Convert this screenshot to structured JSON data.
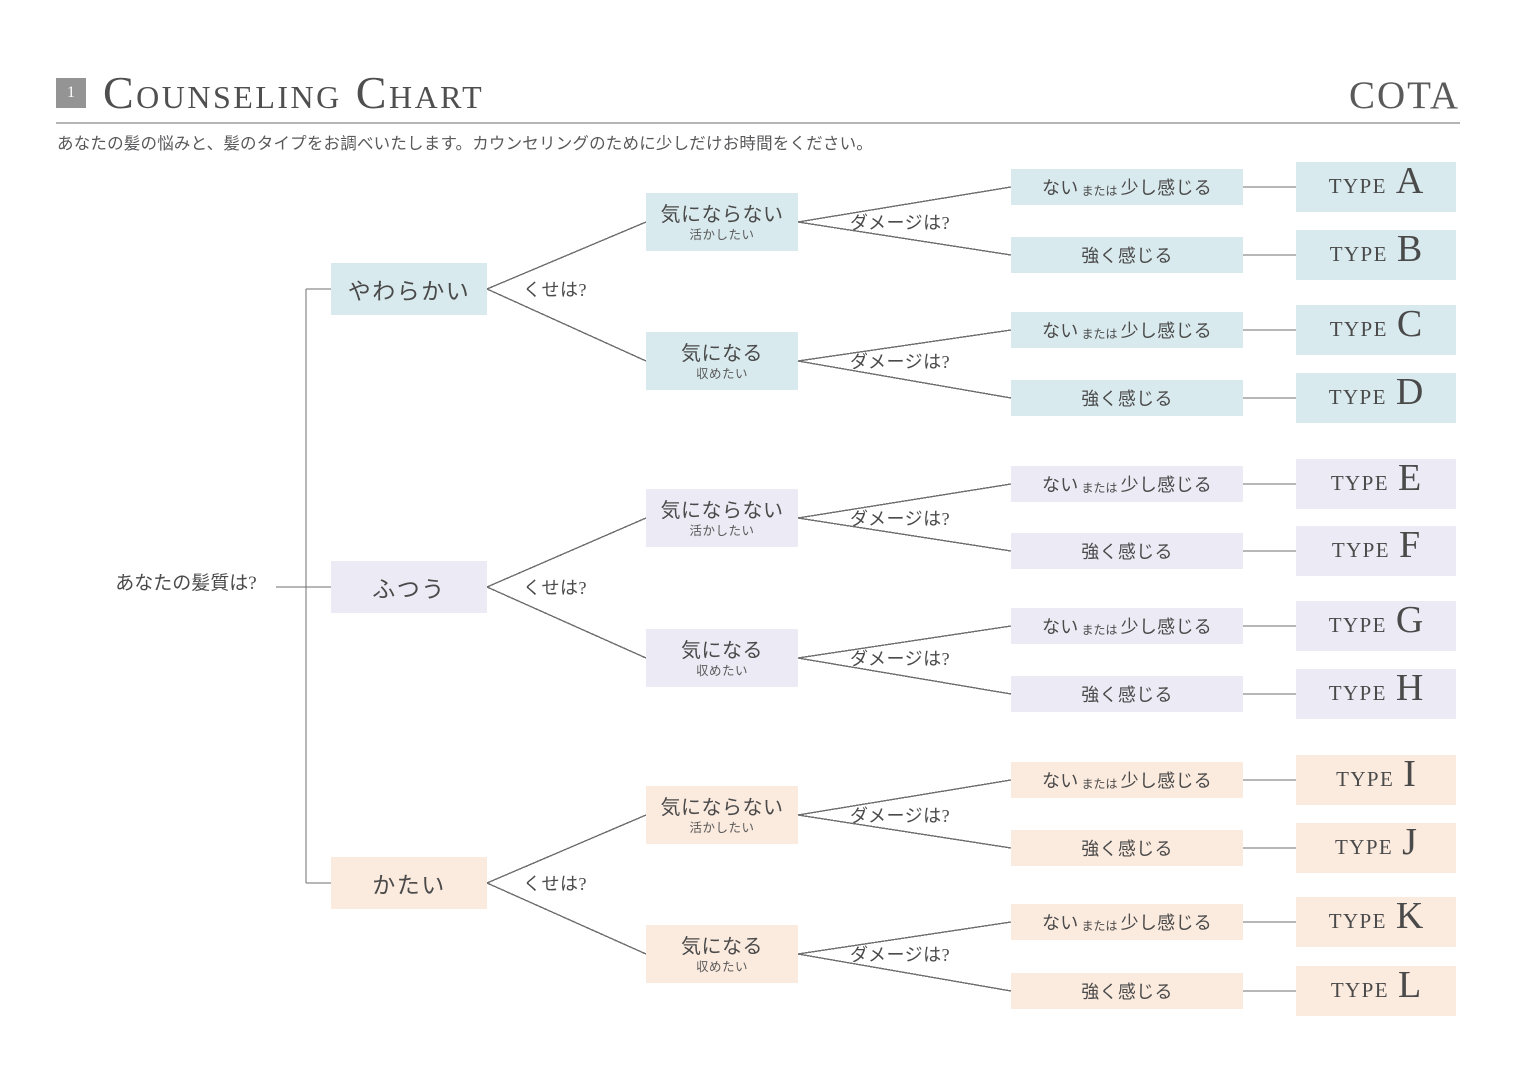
{
  "header": {
    "badge_number": "1",
    "title": "Counseling Chart",
    "brand": "COTA",
    "subtitle": "あなたの髪の悩みと、髪のタイプをお調べいたします。カウンセリングのために少しだけお時間をください。"
  },
  "colors": {
    "blue": "#d9eaee",
    "purple": "#eceaf4",
    "cream": "#fbeade",
    "line": "#6f6f6f",
    "text": "#4a4a4a",
    "badge": "#949494",
    "rule": "#b5b5b5"
  },
  "chart_data": {
    "type": "tree",
    "root_question": "あなたの髪質は?",
    "edge_labels": {
      "level1": "くせは?",
      "level2": "ダメージは?"
    },
    "branches": [
      {
        "texture": "やわらかい",
        "color_key": "blue",
        "curls": [
          {
            "main": "気にならない",
            "sub": "活かしたい",
            "damage": [
              {
                "label_pre": "ない",
                "label_mid": "または",
                "label_post": "少し感じる",
                "type_word": "TYPE",
                "type_letter": "A"
              },
              {
                "label_pre": "",
                "label_mid": "",
                "label_post": "強く感じる",
                "type_word": "TYPE",
                "type_letter": "B"
              }
            ]
          },
          {
            "main": "気になる",
            "sub": "収めたい",
            "damage": [
              {
                "label_pre": "ない",
                "label_mid": "または",
                "label_post": "少し感じる",
                "type_word": "TYPE",
                "type_letter": "C"
              },
              {
                "label_pre": "",
                "label_mid": "",
                "label_post": "強く感じる",
                "type_word": "TYPE",
                "type_letter": "D"
              }
            ]
          }
        ]
      },
      {
        "texture": "ふつう",
        "color_key": "purple",
        "curls": [
          {
            "main": "気にならない",
            "sub": "活かしたい",
            "damage": [
              {
                "label_pre": "ない",
                "label_mid": "または",
                "label_post": "少し感じる",
                "type_word": "TYPE",
                "type_letter": "E"
              },
              {
                "label_pre": "",
                "label_mid": "",
                "label_post": "強く感じる",
                "type_word": "TYPE",
                "type_letter": "F"
              }
            ]
          },
          {
            "main": "気になる",
            "sub": "収めたい",
            "damage": [
              {
                "label_pre": "ない",
                "label_mid": "または",
                "label_post": "少し感じる",
                "type_word": "TYPE",
                "type_letter": "G"
              },
              {
                "label_pre": "",
                "label_mid": "",
                "label_post": "強く感じる",
                "type_word": "TYPE",
                "type_letter": "H"
              }
            ]
          }
        ]
      },
      {
        "texture": "かたい",
        "color_key": "cream",
        "curls": [
          {
            "main": "気にならない",
            "sub": "活かしたい",
            "damage": [
              {
                "label_pre": "ない",
                "label_mid": "または",
                "label_post": "少し感じる",
                "type_word": "TYPE",
                "type_letter": "I"
              },
              {
                "label_pre": "",
                "label_mid": "",
                "label_post": "強く感じる",
                "type_word": "TYPE",
                "type_letter": "J"
              }
            ]
          },
          {
            "main": "気になる",
            "sub": "収めたい",
            "damage": [
              {
                "label_pre": "ない",
                "label_mid": "または",
                "label_post": "少し感じる",
                "type_word": "TYPE",
                "type_letter": "K"
              },
              {
                "label_pre": "",
                "label_mid": "",
                "label_post": "強く感じる",
                "type_word": "TYPE",
                "type_letter": "L"
              }
            ]
          }
        ]
      }
    ]
  }
}
